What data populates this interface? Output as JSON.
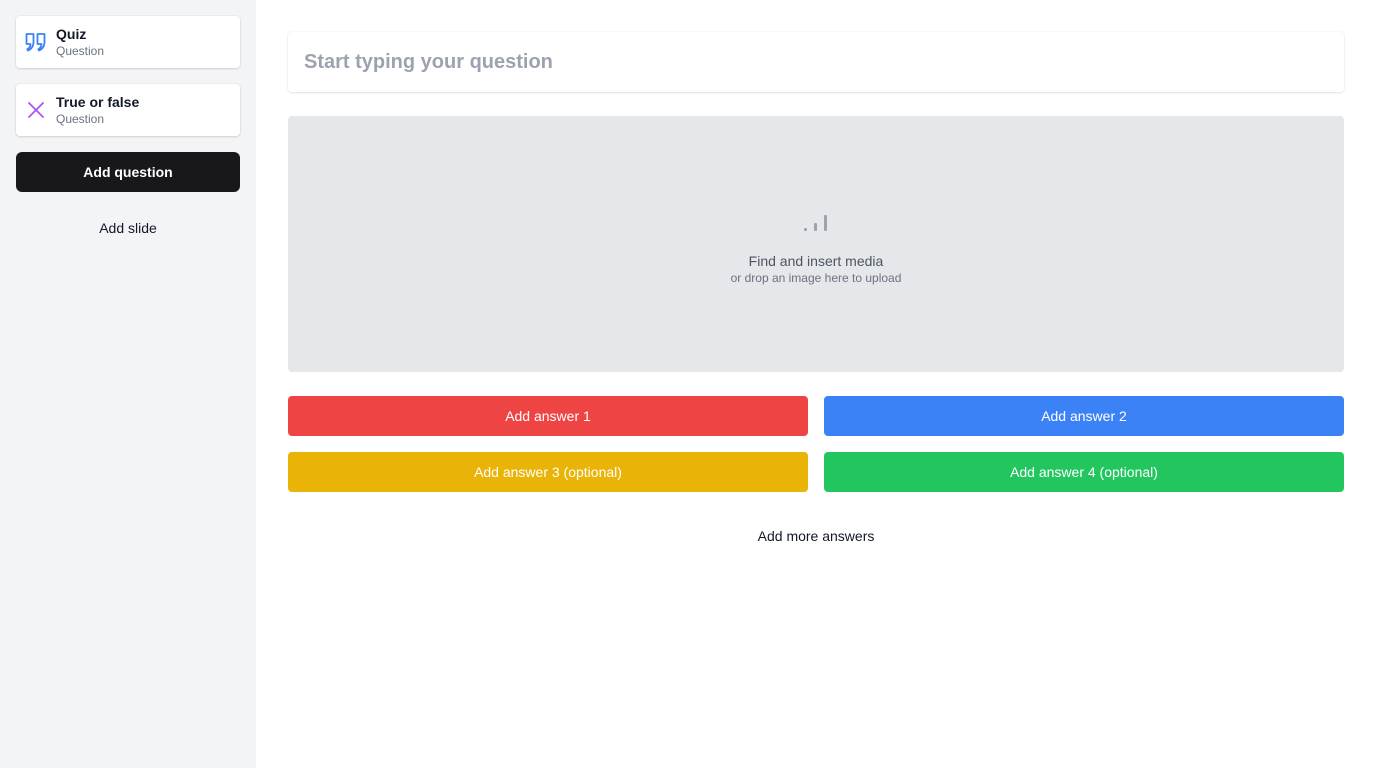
{
  "sidebar": {
    "questions": [
      {
        "title": "Quiz",
        "subtitle": "Question",
        "icon": "quote-icon",
        "icon_color": "#3b82f6"
      },
      {
        "title": "True or false",
        "subtitle": "Question",
        "icon": "x-icon",
        "icon_color": "#a855f7"
      }
    ],
    "add_question_label": "Add question",
    "add_slide_label": "Add slide"
  },
  "main": {
    "question_placeholder": "Start typing your question",
    "media": {
      "title": "Find and insert media",
      "subtitle": "or drop an image here to upload",
      "icon": "signal-icon"
    },
    "answers": [
      {
        "label": "Add answer 1",
        "color": "#ef4444"
      },
      {
        "label": "Add answer 2",
        "color": "#3b82f6"
      },
      {
        "label": "Add answer 3 (optional)",
        "color": "#eab308"
      },
      {
        "label": "Add answer 4 (optional)",
        "color": "#22c55e"
      }
    ],
    "add_more_label": "Add more answers"
  }
}
